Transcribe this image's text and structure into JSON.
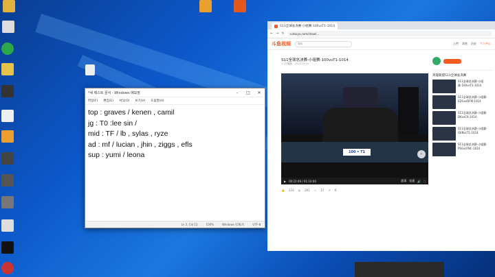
{
  "notepad": {
    "title": "*새 텍스트 문서 - Windows 메모장",
    "menu": [
      "파일(F)",
      "편집(E)",
      "서식(O)",
      "보기(V)",
      "도움말(H)"
    ],
    "lines": [
      "top : graves / kenen , camil",
      "jg : T0 :lee sin /",
      "mid : TF / lb , sylas , ryze",
      "ad : mf / lucian , jhin , ziggs , efls",
      "sup : yumi / leona"
    ],
    "status": [
      "Ln 2, Col 15",
      "100%",
      "Windows (CRLF)",
      "UTF-8"
    ]
  },
  "browser": {
    "tab_title": "S11全球总决赛-小组赛-100vsT1-1014",
    "url": "v.douyu.com/show/...",
    "logo": "斗鱼视频",
    "search_placeholder": "搜索",
    "header_links": [
      "上传",
      "消息",
      "历史",
      "个人中心"
    ],
    "video_title": "S11全球总决赛-小组赛-100vsT1-1014",
    "video_meta": "1.2万播放 · 2021-10-14",
    "scoreboard": "100 • T1",
    "time": "00:22:49 / 01:10:00",
    "quality": "超清",
    "speed": "倍速",
    "side_header": "英雄联盟S11全球总决赛",
    "side_items": [
      "S11全球总决赛-小组赛-100vsT1-1014",
      "S11全球总决赛-小组赛-EDGvsDFM-1014",
      "S11全球总决赛-小组赛-DKvsC9-1014",
      "S11全球总决赛-小组赛-GENvsT1-1014",
      "S11全球总决赛-小组赛-PSGvsFNC-1014"
    ],
    "counts": [
      "233",
      "201",
      "17",
      "6"
    ]
  },
  "colors": {
    "accent": "#f25d22",
    "desktop": "#0c57c9"
  }
}
